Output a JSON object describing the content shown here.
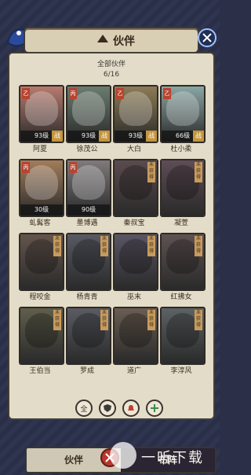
{
  "header": {
    "title": "伙伴",
    "close_icon": "close-icon",
    "header_icon": "partners-icon"
  },
  "summary": {
    "title": "全部伙伴",
    "count": "6/16"
  },
  "cards": [
    {
      "name": "阿夏",
      "level": "93级",
      "badge": "乙",
      "status": "",
      "fight": "战",
      "tint": "#b57b6e"
    },
    {
      "name": "徐茂公",
      "level": "93级",
      "badge": "丙",
      "status": "",
      "fight": "战",
      "tint": "#6b7c6e"
    },
    {
      "name": "大白",
      "level": "93级",
      "badge": "乙",
      "status": "",
      "fight": "战",
      "tint": "#8d7b55"
    },
    {
      "name": "杜小柔",
      "level": "66级",
      "badge": "乙",
      "status": "",
      "fight": "战",
      "tint": "#8aa6a3"
    },
    {
      "name": "虬髯客",
      "level": "30级",
      "badge": "丙",
      "status": "",
      "fight": "",
      "tint": "#a27c5a"
    },
    {
      "name": "墨博遇",
      "level": "90级",
      "badge": "丙",
      "status": "",
      "fight": "",
      "tint": "#7f7a7c"
    },
    {
      "name": "秦叔宝",
      "level": "",
      "badge": "",
      "status": "未获得",
      "fight": "",
      "tint": "#5b4b4e"
    },
    {
      "name": "凝萱",
      "level": "",
      "badge": "",
      "status": "未获得",
      "fight": "",
      "tint": "#5e4d56"
    },
    {
      "name": "程咬金",
      "level": "",
      "badge": "",
      "status": "未获得",
      "fight": "",
      "tint": "#64554c"
    },
    {
      "name": "杨青青",
      "level": "",
      "badge": "",
      "status": "未获得",
      "fight": "",
      "tint": "#585a63"
    },
    {
      "name": "巫末",
      "level": "",
      "badge": "",
      "status": "未获得",
      "fight": "",
      "tint": "#5a5564"
    },
    {
      "name": "红拂女",
      "level": "",
      "badge": "",
      "status": "未获得",
      "fight": "",
      "tint": "#5f5252"
    },
    {
      "name": "王伯当",
      "level": "",
      "badge": "",
      "status": "未获得",
      "fight": "",
      "tint": "#605e4c"
    },
    {
      "name": "罗成",
      "level": "",
      "badge": "",
      "status": "未获得",
      "fight": "",
      "tint": "#5a5c63"
    },
    {
      "name": "道广",
      "level": "",
      "badge": "",
      "status": "未获得",
      "fight": "",
      "tint": "#6a5d53"
    },
    {
      "name": "李淳风",
      "level": "",
      "badge": "",
      "status": "未获得",
      "fight": "",
      "tint": "#5d6264"
    }
  ],
  "filters": [
    {
      "label": "全",
      "icon": "all-filter-icon"
    },
    {
      "label": "",
      "icon": "shield-filter-icon"
    },
    {
      "label": "",
      "icon": "bell-filter-icon"
    },
    {
      "label": "",
      "icon": "plus-filter-icon"
    }
  ],
  "tabs": {
    "left": "伙伴",
    "right": "布阵"
  },
  "watermark": {
    "text": "一听下载"
  }
}
